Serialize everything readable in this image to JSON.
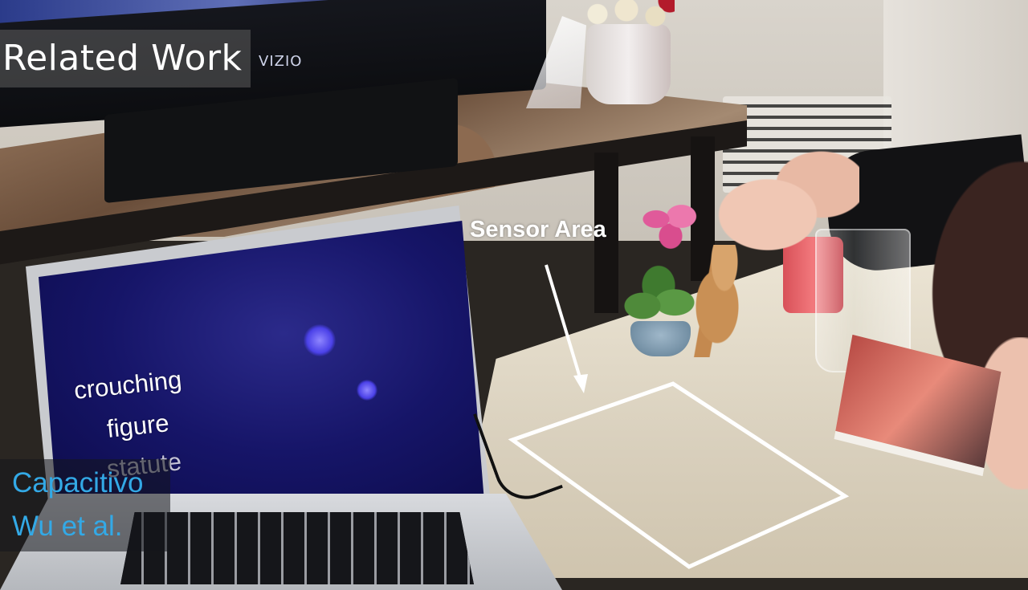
{
  "title": "Related Work",
  "tv": {
    "brand": "VIZIO"
  },
  "laptop_screen": {
    "lines": [
      "crouching",
      "figure",
      "statute"
    ]
  },
  "annotation": {
    "label": "Sensor Area",
    "color": "#ffffff"
  },
  "caption": {
    "line1": "Capacitivo",
    "line2": "Wu et al.",
    "color": "#33a9e6"
  }
}
